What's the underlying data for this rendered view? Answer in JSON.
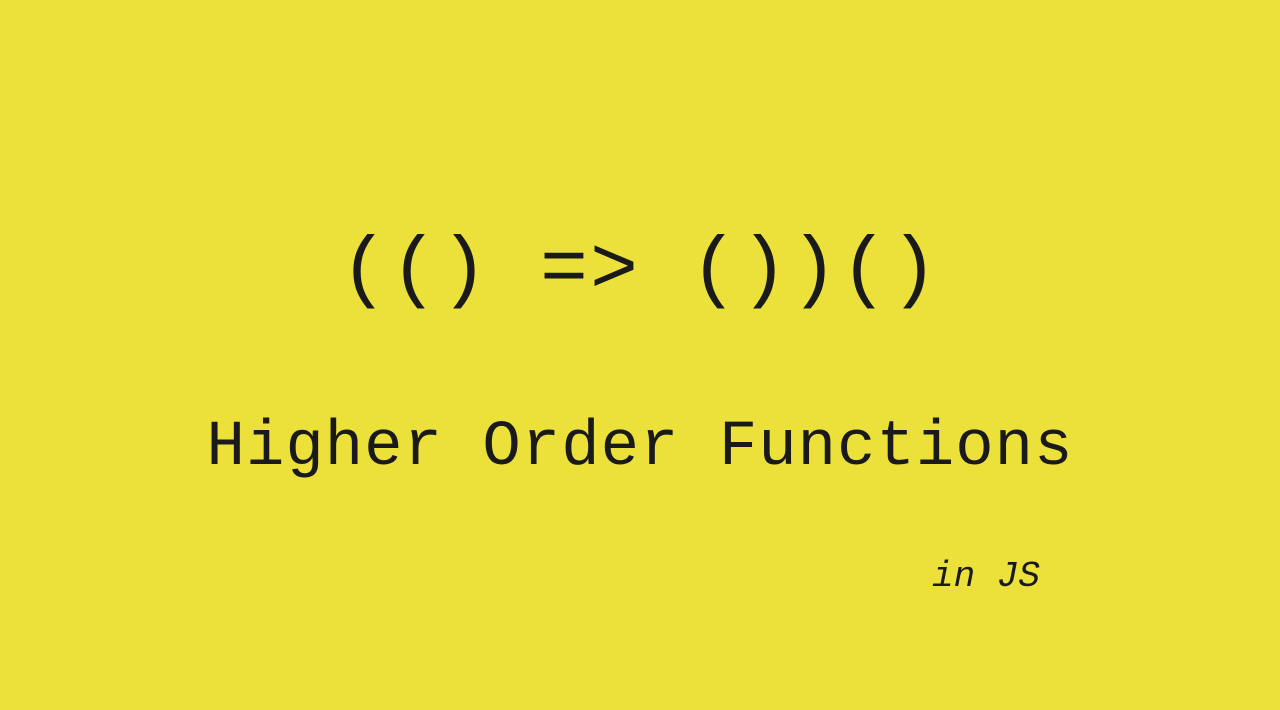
{
  "slide": {
    "code": "(() => ())()",
    "title": "Higher Order Functions",
    "subtitle": "in JS",
    "background_color": "#ece13b",
    "text_color": "#1a1a1a"
  }
}
